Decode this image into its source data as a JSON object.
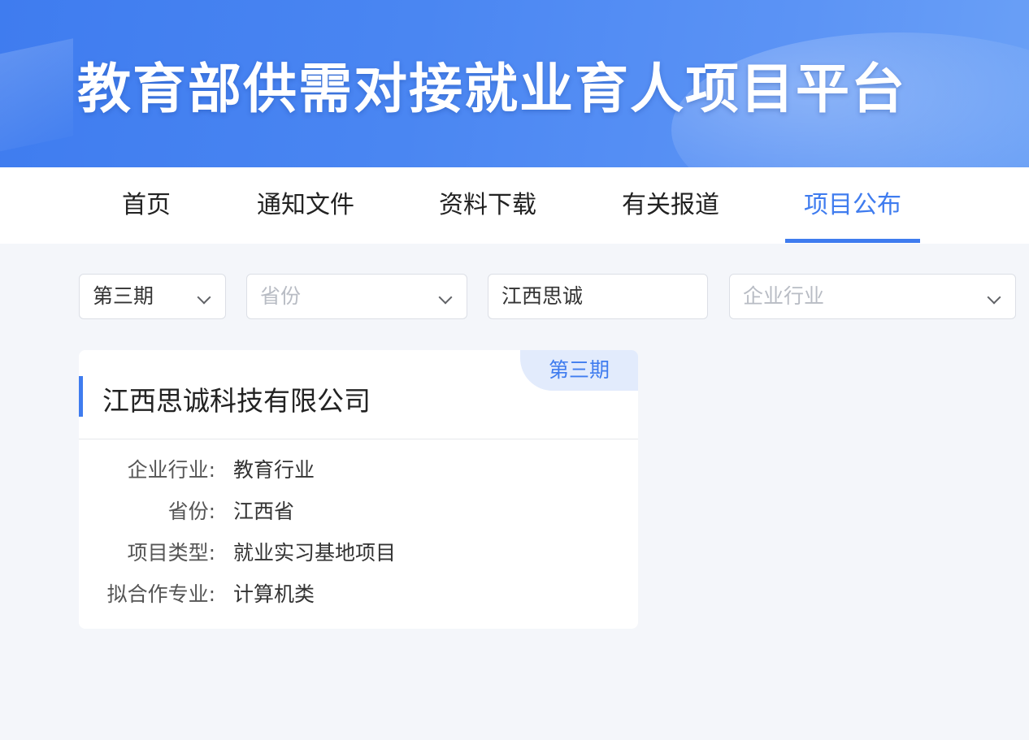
{
  "banner": {
    "title": "教育部供需对接就业育人项目平台"
  },
  "nav": {
    "items": [
      {
        "label": "首页"
      },
      {
        "label": "通知文件"
      },
      {
        "label": "资料下载"
      },
      {
        "label": "有关报道"
      },
      {
        "label": "项目公布"
      }
    ],
    "active_index": 4
  },
  "filters": {
    "period": {
      "value": "第三期"
    },
    "province": {
      "placeholder": "省份"
    },
    "keyword": {
      "value": "江西思诚"
    },
    "industry": {
      "placeholder": "企业行业"
    }
  },
  "card": {
    "title": "江西思诚科技有限公司",
    "tag": "第三期",
    "fields": [
      {
        "label": "企业行业:",
        "value": "教育行业"
      },
      {
        "label": "省份:",
        "value": "江西省"
      },
      {
        "label": "项目类型:",
        "value": "就业实习基地项目"
      },
      {
        "label": "拟合作专业:",
        "value": "计算机类"
      }
    ]
  },
  "colors": {
    "accent": "#3f7cef",
    "page_bg": "#f4f6fa",
    "tag_bg": "#e2ebfc"
  },
  "icons": {
    "dropdown": "chevron-down-icon"
  }
}
